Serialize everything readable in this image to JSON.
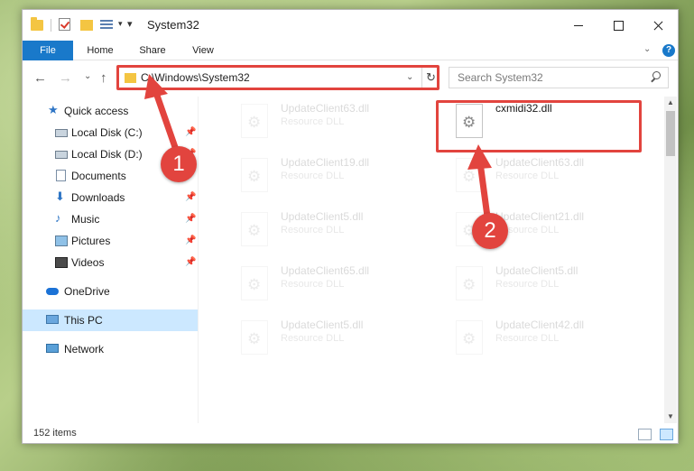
{
  "window": {
    "title": "System32"
  },
  "ribbon": {
    "tabs": [
      "File",
      "Home",
      "Share",
      "View"
    ]
  },
  "navbar": {
    "address": "C:\\Windows\\System32",
    "search_placeholder": "Search System32"
  },
  "sidebar": {
    "items": [
      {
        "label": "Quick access",
        "icon": "star-icon",
        "pinned": false
      },
      {
        "label": "Local Disk (C:)",
        "icon": "drive-icon",
        "pinned": true
      },
      {
        "label": "Local Disk (D:)",
        "icon": "drive-icon",
        "pinned": true
      },
      {
        "label": "Documents",
        "icon": "documents-icon",
        "pinned": false
      },
      {
        "label": "Downloads",
        "icon": "download-icon",
        "pinned": true
      },
      {
        "label": "Music",
        "icon": "music-icon",
        "pinned": true
      },
      {
        "label": "Pictures",
        "icon": "pictures-icon",
        "pinned": true
      },
      {
        "label": "Videos",
        "icon": "videos-icon",
        "pinned": true
      },
      {
        "label": "OneDrive",
        "icon": "cloud-icon",
        "pinned": false
      },
      {
        "label": "This PC",
        "icon": "computer-icon",
        "pinned": false,
        "selected": true
      },
      {
        "label": "Network",
        "icon": "network-icon",
        "pinned": false
      }
    ]
  },
  "files": {
    "left_column": [
      {
        "name": "UpdateClient63.dll",
        "type": "Resource DLL"
      },
      {
        "name": "UpdateClient19.dll",
        "type": "Resource DLL"
      },
      {
        "name": "UpdateClient5.dll",
        "type": "Resource DLL"
      },
      {
        "name": "UpdateClient65.dll",
        "type": "Resource DLL"
      },
      {
        "name": "UpdateClient5.dll",
        "type": "Resource DLL"
      }
    ],
    "right_column": [
      {
        "name": "cxmidi32.dll",
        "type": ""
      },
      {
        "name": "UpdateClient63.dll",
        "type": "Resource DLL"
      },
      {
        "name": "UpdateClient21.dll",
        "type": "Resource DLL"
      },
      {
        "name": "UpdateClient5.dll",
        "type": "Resource DLL"
      },
      {
        "name": "UpdateClient42.dll",
        "type": "Resource DLL"
      }
    ]
  },
  "status": {
    "item_count": "152 items"
  },
  "annotations": {
    "callout_1": "1",
    "callout_2": "2",
    "color": "#e2443e"
  },
  "colors": {
    "accent": "#1979ca",
    "selection": "#cce8ff"
  }
}
